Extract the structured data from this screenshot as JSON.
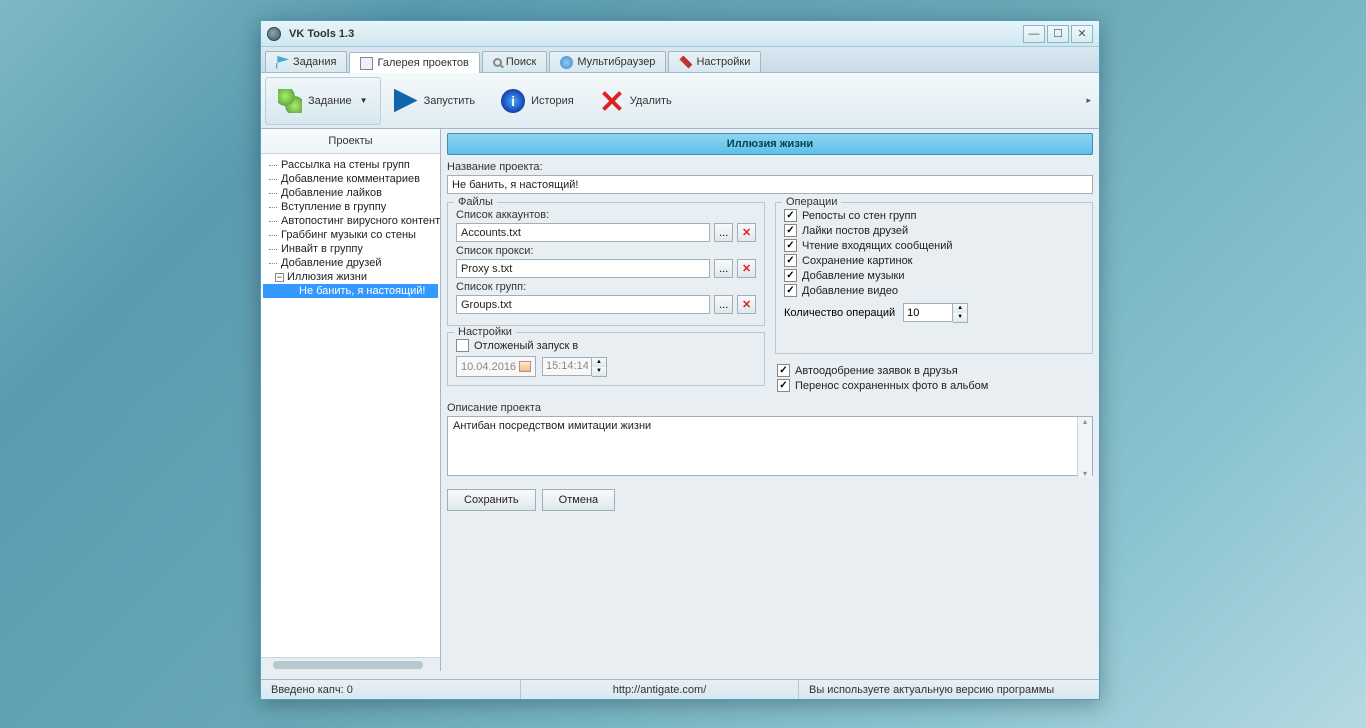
{
  "window": {
    "title": "VK Tools  1.3"
  },
  "tabs": [
    {
      "label": "Задания"
    },
    {
      "label": "Галерея проектов"
    },
    {
      "label": "Поиск"
    },
    {
      "label": "Мультибраузер"
    },
    {
      "label": "Настройки"
    }
  ],
  "toolbar": {
    "task": "Задание",
    "run": "Запустить",
    "history": "История",
    "delete": "Удалить"
  },
  "sidepanel": {
    "header": "Проекты",
    "items": [
      "Рассылка на стены групп",
      "Добавление комментариев",
      "Добавление лайков",
      "Вступление в группу",
      "Автопостинг вирусного контента",
      "Граббинг музыки со стены",
      "Инвайт в группу",
      "Добавление друзей"
    ],
    "parent": "Иллюзия жизни",
    "child": "Не банить, я настоящий!"
  },
  "main": {
    "header": "Иллюзия жизни",
    "name_label": "Название проекта:",
    "name_value": "Не банить, я настоящий!",
    "files_legend": "Файлы",
    "accounts_label": "Список аккаунтов:",
    "accounts_value": "Accounts.txt",
    "proxy_label": "Список прокси:",
    "proxy_value": "Proxy s.txt",
    "groups_label": "Список групп:",
    "groups_value": "Groups.txt",
    "browse": "...",
    "settings_legend": "Настройки",
    "deferred_label": "Отложеный запуск в",
    "date_value": "10.04.2016",
    "time_value": "15:14:14",
    "ops_legend": "Операции",
    "ops": [
      "Репосты со стен групп",
      "Лайки постов друзей",
      "Чтение входящих сообщений",
      "Сохранение картинок",
      "Добавление музыки",
      "Добавление видео"
    ],
    "ops_count_label": "Количество операций",
    "ops_count_value": "10",
    "auto_approve": "Автоодобрение заявок в друзья",
    "move_photos": "Перенос сохраненных фото в альбом",
    "desc_label": "Описание проекта",
    "desc_value": "Антибан посредством имитации жизни",
    "save": "Сохранить",
    "cancel": "Отмена"
  },
  "status": {
    "captcha": "Введено капч: 0",
    "url": "http://antigate.com/",
    "version": "Вы используете актуальную версию программы"
  }
}
